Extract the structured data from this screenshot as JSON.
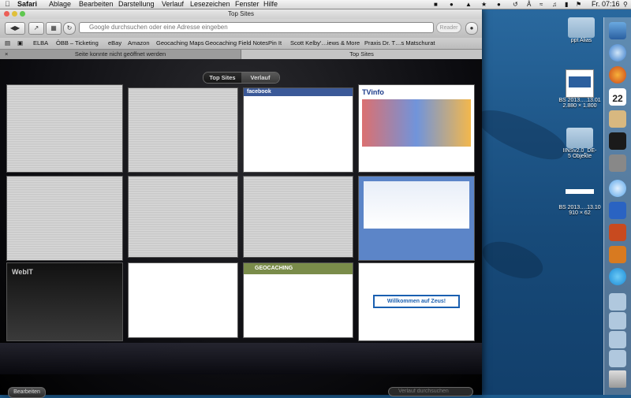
{
  "menubar": {
    "app": "Safari",
    "items": [
      "Ablage",
      "Bearbeiten",
      "Darstellung",
      "Verlauf",
      "Lesezeichen",
      "Fenster",
      "Hilfe"
    ],
    "clock": "Fr. 07:16"
  },
  "window": {
    "title": "Top Sites",
    "address_placeholder": "Google durchsuchen oder eine Adresse eingeben",
    "reader_label": "Reader",
    "bookmarks": [
      "ELBA",
      "ÖBB – Ticketing",
      "eBay",
      "Amazon",
      "Geocaching Maps",
      "Geocaching Field Notes",
      "Pin It",
      "Scott Kelby'…iews & More",
      "Praxis Dr. T…s Matschurat"
    ],
    "tabs": [
      "Seite konnte nicht geöffnet werden",
      "Top Sites"
    ],
    "segments": [
      "Top Sites",
      "Verlauf"
    ],
    "edit_label": "Bearbeiten",
    "history_search_placeholder": "Verlauf durchsuchen"
  },
  "thumbnails": [
    {
      "label": ""
    },
    {
      "label": ""
    },
    {
      "label": "facebook"
    },
    {
      "label": "TVinfo"
    },
    {
      "label": ""
    },
    {
      "label": ""
    },
    {
      "label": ""
    },
    {
      "label": ""
    },
    {
      "label": "WebIT"
    },
    {
      "label": ""
    },
    {
      "label": "GEOCACHING"
    },
    {
      "label": "Willkommen auf Zeus!"
    }
  ],
  "desktop": {
    "icons": [
      {
        "label": "ppt Alias"
      },
      {
        "label": "BS 2013….13.01",
        "sub": "2.880 × 1.800"
      },
      {
        "label": "IINSv2.0_DE-",
        "sub": "5 Objekte"
      },
      {
        "label": "BS 2013….13.10",
        "sub": "910 × 62"
      }
    ]
  },
  "dock": {
    "icons": [
      "finder-icon",
      "safari-icon",
      "firefox-icon",
      "calendar-icon",
      "notes-icon",
      "terminal-icon",
      "system-prefs-icon",
      "messages-icon",
      "word-icon",
      "powerpoint-icon",
      "skype-icon",
      "folder-icon",
      "folder-icon",
      "folder-icon",
      "folder-icon",
      "folder-icon",
      "trash-icon"
    ],
    "calendar_day": "22"
  }
}
